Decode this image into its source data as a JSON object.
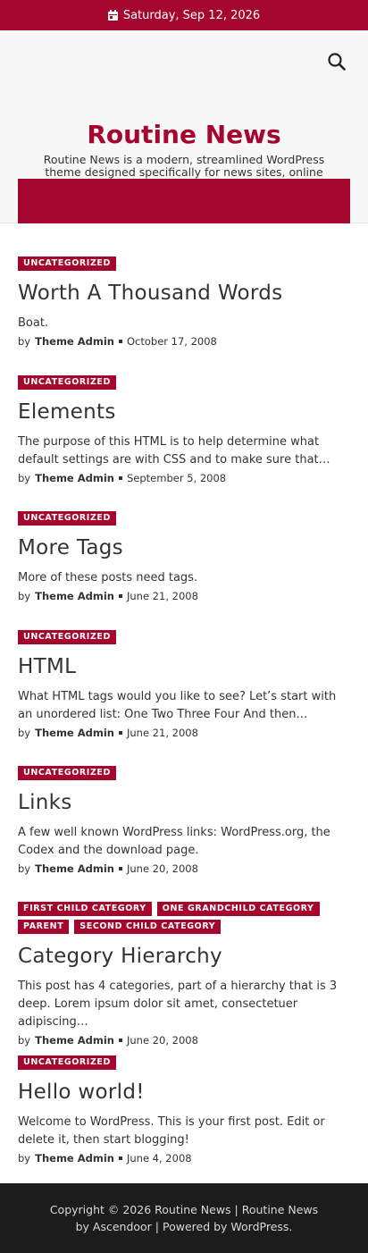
{
  "topbar": {
    "date": "Saturday, Sep 12, 2026"
  },
  "header": {
    "title": "Routine News",
    "description": "Routine News is a modern, streamlined WordPress theme designed specifically for news sites, online magazines, and content portals."
  },
  "posts": [
    {
      "categories": [
        "UNCATEGORIZED"
      ],
      "title": "Worth A Thousand Words",
      "excerpt": "Boat.",
      "by": "by",
      "author": "Theme Admin",
      "date": "October 17, 2008"
    },
    {
      "categories": [
        "UNCATEGORIZED"
      ],
      "title": "Elements",
      "excerpt": "The purpose of this HTML is to help determine what default settings are with CSS and to make sure that…",
      "by": "by",
      "author": "Theme Admin",
      "date": "September 5, 2008"
    },
    {
      "categories": [
        "UNCATEGORIZED"
      ],
      "title": "More Tags",
      "excerpt": "More of these posts need tags.",
      "by": "by",
      "author": "Theme Admin",
      "date": "June 21, 2008"
    },
    {
      "categories": [
        "UNCATEGORIZED"
      ],
      "title": "HTML",
      "excerpt": "What HTML tags would you like to see? Let’s start with an unordered list: One Two Three Four And then…",
      "by": "by",
      "author": "Theme Admin",
      "date": "June 21, 2008"
    },
    {
      "categories": [
        "UNCATEGORIZED"
      ],
      "title": "Links",
      "excerpt": "A few well known WordPress links: WordPress.org, the Codex and the download page.",
      "by": "by",
      "author": "Theme Admin",
      "date": "June 20, 2008"
    },
    {
      "categories": [
        "FIRST CHILD CATEGORY",
        "ONE GRANDCHILD CATEGORY",
        "PARENT",
        "SECOND CHILD CATEGORY"
      ],
      "title": "Category Hierarchy",
      "excerpt": "This post has 4 categories, part of a hierarchy that is 3 deep. Lorem ipsum dolor sit amet, consectetuer adipiscing…",
      "by": "by",
      "author": "Theme Admin",
      "date": "June 20, 2008"
    },
    {
      "categories": [
        "UNCATEGORIZED"
      ],
      "title": "Hello world!",
      "excerpt": "Welcome to WordPress. This is your first post. Edit or delete it, then start blogging!",
      "by": "by",
      "author": "Theme Admin",
      "date": "June 4, 2008"
    }
  ],
  "footer": {
    "copyright": "Copyright © 2026 Routine News | ",
    "theme_link": "Routine News",
    "by_text": " by ",
    "author_link": "Ascendoor",
    "separator": " | ",
    "powered_link": "Powered by WordPress."
  }
}
